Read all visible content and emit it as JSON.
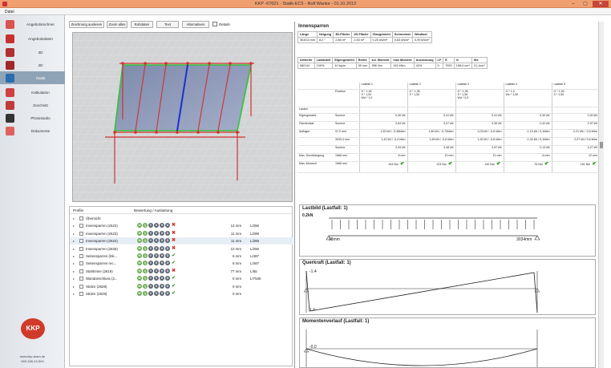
{
  "window": {
    "title": "KKP -67621 - Statik-EC5 - Rolf Wanke - 01.10.2013",
    "minimize": "–",
    "maximize": "▢",
    "close": "✕"
  },
  "menu": {
    "file": "Datei"
  },
  "sidebar": {
    "items": [
      {
        "label": "Angebotsrechner",
        "icon": "calculator-icon",
        "color": "#d9534f"
      },
      {
        "label": "Angebotsdaten",
        "icon": "house-data-icon",
        "color": "#c9302c"
      },
      {
        "label": "3D",
        "icon": "cube-3d-icon",
        "color": "#b03030"
      },
      {
        "label": "2D",
        "icon": "plan-2d-icon",
        "color": "#a02828"
      },
      {
        "label": "Statik",
        "icon": "statics-icon",
        "color": "#2b6cb0",
        "active": true
      },
      {
        "label": "Kalkulation",
        "icon": "calculation-icon",
        "color": "#d04040"
      },
      {
        "label": "Zuschnitt",
        "icon": "cutting-icon",
        "color": "#c03a3a"
      },
      {
        "label": "Photostudio",
        "icon": "camera-icon",
        "color": "#333333"
      },
      {
        "label": "Dokumente",
        "icon": "documents-icon",
        "color": "#e06060"
      }
    ],
    "logo": "KKP",
    "website": "www.kkp-team.de",
    "phone": "069-186-24-594"
  },
  "toolbar": {
    "buttons": [
      "Zeichnung auslesen",
      "Zoom alles",
      "Rohdaten",
      "Text",
      "Alternativen"
    ],
    "details_label": "Details",
    "details_checked": false
  },
  "tree": {
    "col_profile": "Profile",
    "col_rating": "Bewertung / Auslastung",
    "rows": [
      {
        "name": "Übersicht",
        "dots": [],
        "mark": "",
        "mm": "",
        "ratio": ""
      },
      {
        "name": "Innensparren (2622)",
        "dots": [
          "M",
          "Q",
          "V",
          "S",
          "H",
          "D"
        ],
        "mark": "bad",
        "mm": "12 mm",
        "ratio": "L/256"
      },
      {
        "name": "Innensparren (2623)",
        "dots": [
          "M",
          "Q",
          "V",
          "S",
          "H",
          "D"
        ],
        "mark": "bad",
        "mm": "11 mm",
        "ratio": "L/289"
      },
      {
        "name": "Innensparren (2624)",
        "dots": [
          "M",
          "Q",
          "V",
          "S",
          "H",
          "D"
        ],
        "mark": "bad",
        "mm": "11 mm",
        "ratio": "L/289"
      },
      {
        "name": "Innensparren (2625)",
        "dots": [
          "M",
          "Q",
          "V",
          "S",
          "H",
          "D"
        ],
        "mark": "bad",
        "mm": "12 mm",
        "ratio": "L/256"
      },
      {
        "name": "Seitensparren (lnk...",
        "dots": [
          "M",
          "Q",
          "V",
          "S",
          "H",
          "D"
        ],
        "mark": "ok",
        "mm": "6 mm",
        "ratio": "L/487"
      },
      {
        "name": "Seitensparren rec...",
        "dots": [
          "M",
          "Q",
          "V",
          "S",
          "H",
          "D"
        ],
        "mark": "ok",
        "mm": "6 mm",
        "ratio": "L/487"
      },
      {
        "name": "Stahlrinne (2619)",
        "dots": [
          "M",
          "Q",
          "V",
          "S",
          "H",
          "D"
        ],
        "mark": "bad",
        "mm": "77 mm",
        "ratio": "L/65"
      },
      {
        "name": "Wandanschluss (2...",
        "dots": [
          "M",
          "Q",
          "V",
          "S",
          "H",
          "D"
        ],
        "mark": "ok",
        "mm": "0 mm",
        "ratio": "L/7530"
      },
      {
        "name": "Stütze (2628)",
        "dots": [
          "M",
          "Q",
          "V",
          "S",
          "H",
          "D"
        ],
        "mark": "ok",
        "mm": "0 mm",
        "ratio": ""
      },
      {
        "name": "Stütze (2629)",
        "dots": [
          "M",
          "Q",
          "V",
          "S",
          "H",
          "D"
        ],
        "mark": "ok",
        "mm": "0 mm",
        "ratio": ""
      }
    ]
  },
  "innensparren": {
    "title": "Innensparren",
    "geo": {
      "headers": [
        "Länge",
        "Neigung",
        "3D-Fläche",
        "2D-Fläche",
        "Glasgewicht",
        "Schneelast",
        "Windlast"
      ],
      "values": [
        "3033,6 mm",
        "8,2 °",
        "2,86 m²",
        "2,83 m²",
        "0,25 kN/m²",
        "0,63 kN/m²",
        "0,99 kN/m²"
      ]
    },
    "profile": {
      "headers": [
        "Artikelnr",
        "Lastanteil",
        "Eigengewicht",
        "Breite",
        "zul. Moment",
        "max Moment",
        "Ausnutzung",
        "LF",
        "E",
        "Ix",
        "Wx"
      ],
      "values": [
        "580110",
        "100%",
        "10 kg/m",
        "30 mm",
        "356 Nm",
        "151 kNm",
        "42%",
        "5",
        "7000",
        "158,4 cm⁴",
        "21,1cm³"
      ]
    },
    "loadcases": {
      "headers": [
        "Lastfall 1",
        "Lastfall 2",
        "Lastfall 3",
        "Lastfall 4",
        "Lastfall 5"
      ],
      "position_label": "Position",
      "position": [
        [
          "G * 1,00",
          "S * 1,00",
          "Wd * 1,0"
        ],
        [
          "G * 1,35",
          "S * 1,50"
        ],
        [
          "G * 1,35",
          "S * 1,50",
          "Wd * 0,9"
        ],
        [
          "G * 1,0",
          "Ws * 1,50"
        ],
        [
          "G * 1,00",
          "S * 1,50"
        ]
      ],
      "lasten_label": "Lasten",
      "eigengewicht_label": "Eigengewicht",
      "summe_label": "Summe",
      "eigengewicht": [
        "0,30 kN",
        "0,41 kN",
        "0,41 kN",
        "0,30 kN",
        "0,30 kN"
      ],
      "flaechenlast_label": "Flächenlast",
      "flaechenlast": [
        "2,64 kN",
        "3,07 kN",
        "3,36 kN",
        "-2,42 kN",
        "2,97 kN"
      ],
      "auflager_label": "Auflager",
      "auflager_a_pos": "97,0 mm",
      "auflager_a": [
        "1,52 kN / -0,45kNm",
        "1,80 kN / -0,70kNm",
        "2,03 kN / -0,6 kNm",
        "-1,10 kN / 0,1kNm",
        "2,21 kN / -0,6 kNm"
      ],
      "auflager_b_pos": "3033,4 mm",
      "auflager_b": [
        "1,42 kN / -0,4 kNm",
        "1,69 kN / -0,6 kNm",
        "1,92 kN / -0,6 kNm",
        "-1,03 kN / 0,1kNm",
        "2,07 kN / 0,6 kNm"
      ],
      "summe_auflager": [
        "2,94 kN",
        "3,48 kN",
        "3,97 kN",
        "-2,13 kN",
        "4,27 kN"
      ],
      "durchbiegung_label": "Max. Durchbiegung",
      "durchbiegung_pos": "1566 mm",
      "durchbiegung": [
        "8 mm",
        "10 mm",
        "11 mm",
        "-6 mm",
        "12 mm"
      ],
      "moment_label": "Max. Moment",
      "moment_pos": "1566 mm",
      "moment": [
        "104 Nm",
        "123 Nm",
        "140 Nm",
        "-75 Nm",
        "151 Nm"
      ]
    }
  },
  "lastbild": {
    "title": "Lastbild (Lastfall: 1)",
    "load_label": "0.2kN",
    "left_label": "98mm",
    "right_label": "3034mm"
  },
  "querkraft": {
    "title": "Querkraft (Lastfall: 1)",
    "top_label": "-1.4",
    "bottom_label": "1.4"
  },
  "moment_chart": {
    "title": "Momentenverlauf (Lastfall: 1)",
    "left_label": "-0.0"
  }
}
